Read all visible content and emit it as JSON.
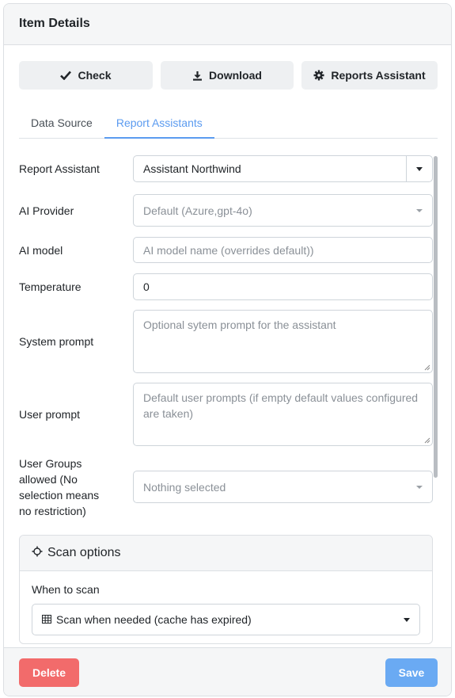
{
  "header": {
    "title": "Item Details"
  },
  "toolbar": {
    "check_label": "Check",
    "download_label": "Download",
    "reports_assistant_label": "Reports Assistant"
  },
  "tabs": [
    {
      "label": "Data Source",
      "active": false
    },
    {
      "label": "Report Assistants",
      "active": true
    }
  ],
  "form": {
    "report_assistant": {
      "label": "Report Assistant",
      "value": "Assistant Northwind"
    },
    "ai_provider": {
      "label": "AI Provider",
      "value": "Default (Azure,gpt-4o)"
    },
    "ai_model": {
      "label": "AI model",
      "placeholder": "AI model name (overrides default))"
    },
    "temperature": {
      "label": "Temperature",
      "value": "0"
    },
    "system_prompt": {
      "label": "System prompt",
      "placeholder": "Optional sytem prompt for the assistant"
    },
    "user_prompt": {
      "label": "User prompt",
      "placeholder": "Default user prompts (if empty default values configured are taken)"
    },
    "user_groups": {
      "label_lines": [
        "User Groups",
        "allowed (No",
        "selection means",
        "no restriction)"
      ],
      "value": "Nothing selected"
    }
  },
  "scan_options": {
    "title": "Scan options",
    "when_label": "When to scan",
    "when_value": "Scan when needed (cache has expired)"
  },
  "footer": {
    "delete_label": "Delete",
    "save_label": "Save"
  },
  "colors": {
    "accent": "#5b9bf0",
    "danger": "#f26b6b",
    "primary": "#6aaaf3"
  },
  "icons": [
    "check-icon",
    "download-icon",
    "cog-icon",
    "sun-icon",
    "table-icon",
    "chevron-down-icon"
  ]
}
